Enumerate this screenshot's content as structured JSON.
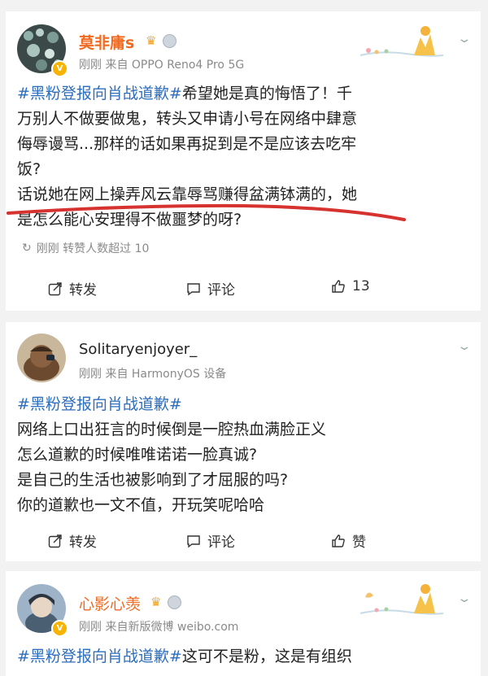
{
  "posts": [
    {
      "username": "莫非庸s",
      "meta": "刚刚  来自 OPPO Reno4 Pro 5G",
      "lines": [
        {
          "tag": "#黑粉登报向肖战道歉#",
          "text": "希望她是真的悔悟了！千"
        },
        {
          "tag": "",
          "text": "万别人不做要做鬼，转头又申请小号在网络中肆意"
        },
        {
          "tag": "",
          "text": "侮辱谩骂...那样的话如果再捉到是不是应该去吃牢"
        },
        {
          "tag": "",
          "text": "饭?"
        },
        {
          "tag": "",
          "text": "话说她在网上操弄风云靠辱骂赚得盆满钵满的，她"
        },
        {
          "tag": "",
          "text": "是怎么能心安理得不做噩梦的呀?"
        }
      ],
      "repost_info": "刚刚 转赞人数超过 10",
      "actions": {
        "repost": "转发",
        "comment": "评论",
        "like": "13"
      }
    },
    {
      "username": "Solitaryenjoyer_",
      "meta": "刚刚  来自 HarmonyOS 设备",
      "lines": [
        {
          "tag": "#黑粉登报向肖战道歉#",
          "text": ""
        },
        {
          "tag": "",
          "text": "网络上口出狂言的时候倒是一腔热血满脸正义"
        },
        {
          "tag": "",
          "text": "怎么道歉的时候唯唯诺诺一脸真诚?"
        },
        {
          "tag": "",
          "text": "是自己的生活也被影响到了才屈服的吗?"
        },
        {
          "tag": "",
          "text": "你的道歉也一文不值，开玩笑呢哈哈"
        }
      ],
      "actions": {
        "repost": "转发",
        "comment": "评论",
        "like": "赞"
      }
    },
    {
      "username": "心影心羡",
      "meta": "刚刚  来自新版微博 weibo.com",
      "lines": [
        {
          "tag": "#黑粉登报向肖战道歉#",
          "text": "这可不是粉，这是有组织"
        }
      ]
    }
  ],
  "colors": {
    "hashtag": "#2b6dbe",
    "username_vip": "#f16a1f",
    "underline": "#d6322f"
  }
}
